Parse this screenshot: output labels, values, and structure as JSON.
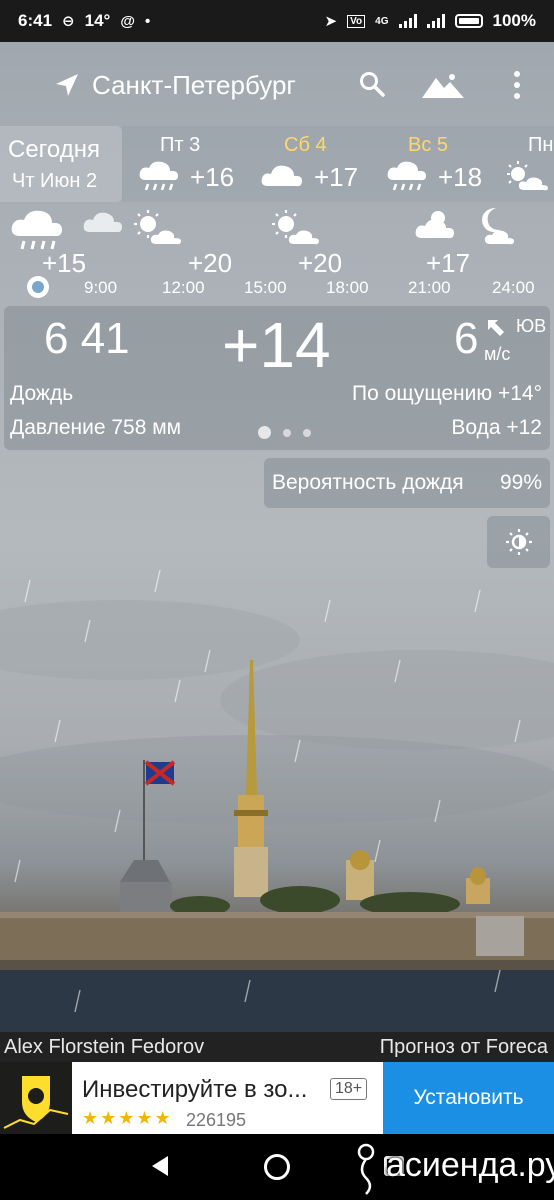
{
  "status_bar": {
    "time": "6:41",
    "temp": "14°",
    "battery": "100%",
    "net": "4G"
  },
  "header": {
    "city": "Санкт-Петербург"
  },
  "today": {
    "label": "Сегодня",
    "date": "Чт Июн 2"
  },
  "days": [
    {
      "name": "Пт 3",
      "temp": "+16",
      "icon": "rain-cloud-icon",
      "weekend": false
    },
    {
      "name": "Сб 4",
      "temp": "+17",
      "icon": "cloud-icon",
      "weekend": true
    },
    {
      "name": "Вс 5",
      "temp": "+18",
      "icon": "rain-cloud-icon",
      "weekend": true
    },
    {
      "name": "Пн",
      "temp": "",
      "icon": "sun-cloud-icon",
      "weekend": false
    }
  ],
  "hourly": {
    "temps": [
      "+15",
      "+20",
      "+20",
      "+17"
    ],
    "times": [
      "9:00",
      "12:00",
      "15:00",
      "18:00",
      "21:00",
      "24:00"
    ]
  },
  "current": {
    "time": "6 41",
    "temp": "+14",
    "wind_speed": "6",
    "wind_dir": "ЮВ",
    "wind_unit": "м/с",
    "condition": "Дождь",
    "feels_like": "По ощущению +14°",
    "pressure": "Давление 758 мм",
    "water": "Вода +12"
  },
  "rain": {
    "label": "Вероятность дождя",
    "value": "99%"
  },
  "credits": {
    "author": "Alex Florstein Fedorov",
    "source": "Прогноз от Foreca"
  },
  "ad": {
    "title": "Инвестируйте в зо...",
    "age": "18+",
    "stars": "★★★★★",
    "reviews": "226195",
    "install": "Установить"
  },
  "watermark": "асиенда.ру",
  "colors": {
    "weekend": "#ffd76a",
    "install": "#1a8fe3"
  }
}
